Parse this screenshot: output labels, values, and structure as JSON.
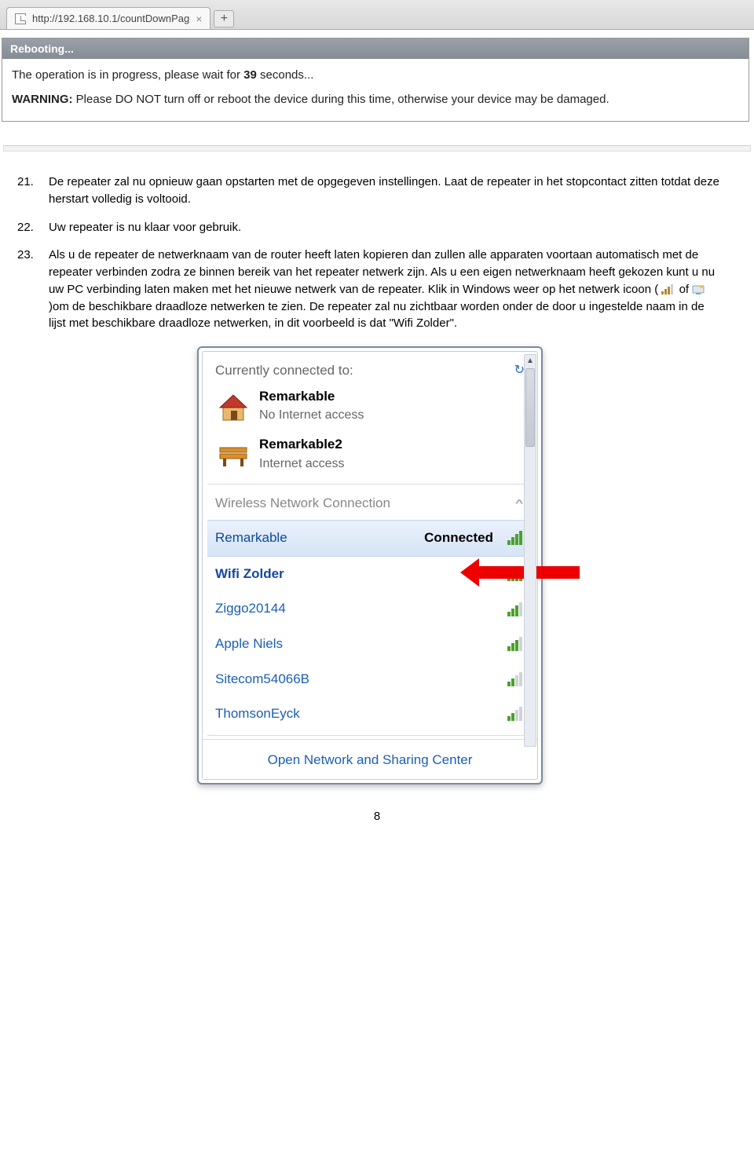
{
  "browser": {
    "tab_title": "http://192.168.10.1/countDownPag",
    "close": "×",
    "plus": "+"
  },
  "reboot": {
    "title": "Rebooting...",
    "line1_a": "The operation is in progress, please wait for ",
    "seconds": "39",
    "line1_b": " seconds...",
    "warn_label": "WARNING:",
    "warn_text": " Please DO NOT turn off or reboot the device during this time, otherwise your device may be damaged."
  },
  "items": {
    "n21": "21.",
    "t21": "De repeater zal nu opnieuw gaan opstarten met de opgegeven instellingen. Laat de repeater in het stopcontact zitten totdat deze herstart volledig is voltooid.",
    "n22": "22.",
    "t22": "Uw repeater is nu klaar voor gebruik.",
    "n23": "23.",
    "t23a": "Als u de repeater de netwerknaam van de router heeft laten kopieren dan zullen alle apparaten voortaan automatisch met de repeater verbinden zodra ze binnen bereik van het repeater netwerk zijn. Als u een eigen netwerknaam heeft gekozen kunt u nu uw PC verbinding laten maken met het nieuwe netwerk van de repeater. Klik in Windows weer op het netwerk icoon (",
    "of": "of ",
    "t23b": ")om de beschikbare draadloze netwerken te zien. De repeater zal nu zichtbaar worden onder de door u ingestelde naam in de lijst met beschikbare draadloze netwerken, in dit voorbeeld is dat \"Wifi Zolder\"."
  },
  "popup": {
    "head": "Currently connected to:",
    "conn1": {
      "name": "Remarkable",
      "sub": "No Internet access"
    },
    "conn2": {
      "name": "Remarkable2",
      "sub": "Internet access"
    },
    "section": "Wireless Network Connection",
    "connected_label": "Connected",
    "open_link": "Open Network and Sharing Center",
    "networks": {
      "n0": "Remarkable",
      "n1": "Wifi Zolder",
      "n2": "Ziggo20144",
      "n3": "Apple Niels",
      "n4": "Sitecom54066B",
      "n5": "ThomsonEyck"
    }
  },
  "page_number": "8"
}
